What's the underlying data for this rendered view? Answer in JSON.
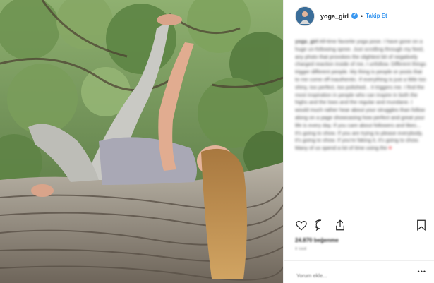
{
  "post": {
    "username": "yoga_girl",
    "verified_mark": "✔",
    "separator": "•",
    "follow_label": "Takip Et",
    "caption_user": "yoga_girl",
    "caption_text": "All-time favorite yoga pose. I have gone on a huge un-following spree. Just scrolling through my feed, any photo that provokes the slightest bit of negatively charged reaction inside of me, I unfollow. Different things trigger different people. My thing is people or posts that to me come off inauthentic. If everything is just a little too shiny, too perfect, too polished... it triggers me. I find the most inspiration in people who can inspire in both the highs and the lows and the regular and mundane. I would much rather hear about your struggles than follow along on a page showcasing how perfect and great your life is every day. If you care about followers and likes... It's going to show. If you are trying to please everybody, it's going to show. If you're faking it, it's going to show. Many of us spend a lot of time using the",
    "caption_heart": "♥",
    "likes": "24.870 beğenme",
    "time": "8 saat",
    "comment_placeholder": "Yorum ekle...",
    "comment_more": "•••"
  },
  "icons": {
    "like": "heart-outline-icon",
    "comment": "speech-bubble-icon",
    "share": "share-upload-icon",
    "save": "bookmark-icon"
  },
  "colors": {
    "accent": "#3897f0",
    "text": "#262626",
    "muted": "#999999",
    "heart": "#ed1c24"
  }
}
